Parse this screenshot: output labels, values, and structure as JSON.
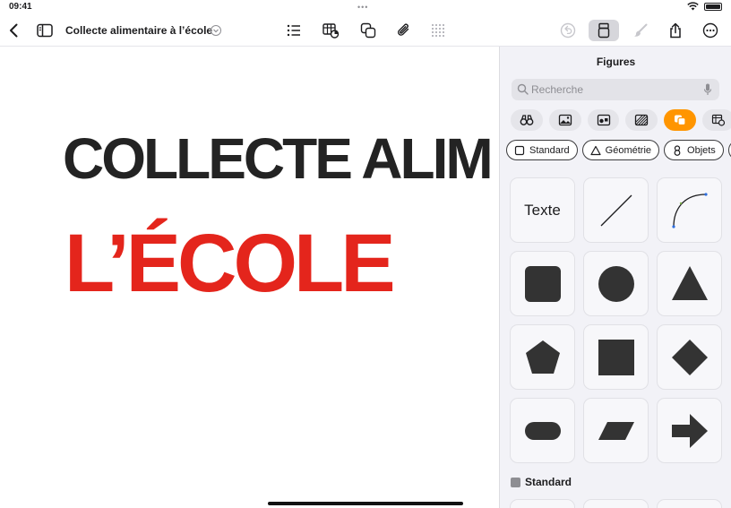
{
  "status": {
    "time": "09:41"
  },
  "document": {
    "title": "Collecte alimentaire à l’école",
    "line1": "COLLECTE ALIM",
    "line2": "L’ÉCOLE"
  },
  "toolbar": {
    "icons": [
      "back-chevron-icon",
      "sidebar-icon",
      "list-icon",
      "table-chart-icon",
      "shapes-icon",
      "paperclip-icon",
      "grid-dots-icon",
      "undo-icon",
      "format-brush-icon",
      "paintbrush-icon",
      "share-icon",
      "more-icon"
    ]
  },
  "panel": {
    "title": "Figures",
    "search": {
      "placeholder": "Recherche",
      "value": ""
    },
    "categories": [
      "binoculars",
      "image",
      "media",
      "texture",
      "shapes",
      "table"
    ],
    "active_category": "shapes",
    "subcategories": [
      {
        "label": "Standard",
        "icon": "square-icon"
      },
      {
        "label": "Géométrie",
        "icon": "triangle-icon"
      },
      {
        "label": "Objets",
        "icon": "objects-icon"
      }
    ],
    "shapes": [
      {
        "name": "text",
        "label": "Texte"
      },
      {
        "name": "line"
      },
      {
        "name": "curve"
      },
      {
        "name": "rounded-square"
      },
      {
        "name": "circle"
      },
      {
        "name": "triangle"
      },
      {
        "name": "pentagon"
      },
      {
        "name": "square"
      },
      {
        "name": "diamond"
      },
      {
        "name": "pill"
      },
      {
        "name": "parallelogram"
      },
      {
        "name": "arrow"
      }
    ],
    "section_label": "Standard"
  },
  "colors": {
    "title_dark": "#232323",
    "title_red": "#e4251c",
    "accent_orange": "#ff9500",
    "shape_fill": "#333333",
    "handle_blue": "#2f6fde"
  }
}
